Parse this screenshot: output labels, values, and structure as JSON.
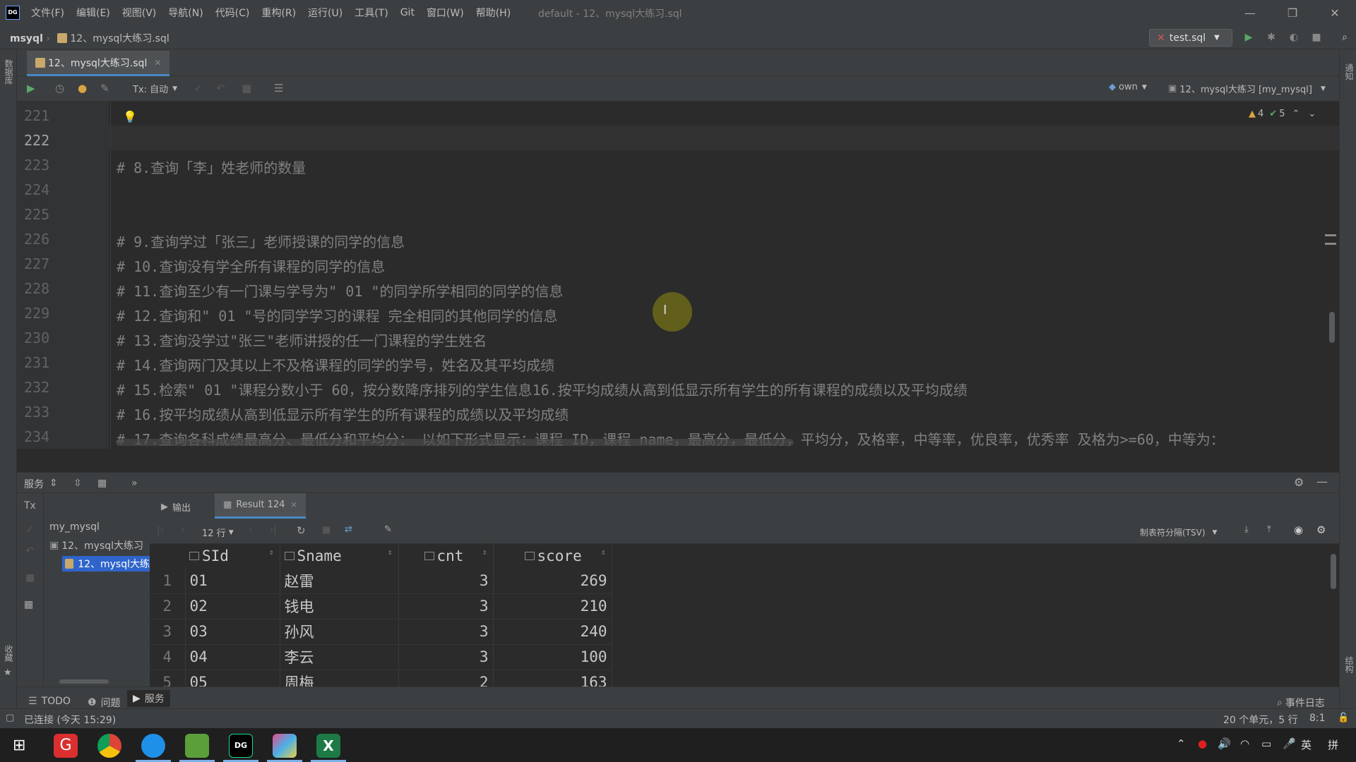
{
  "app": {
    "menu": [
      "文件(F)",
      "编辑(E)",
      "视图(V)",
      "导航(N)",
      "代码(C)",
      "重构(R)",
      "运行(U)",
      "工具(T)",
      "Git",
      "窗口(W)",
      "帮助(H)"
    ],
    "window_title": "default - 12、mysql大练习.sql"
  },
  "nav": {
    "project": "msyql",
    "file": "12、mysql大练习.sql",
    "run_config": "test.sql"
  },
  "editor": {
    "tab_label": "12、mysql大练习.sql",
    "tx_label": "Tx: 自动",
    "schema_label": "own",
    "datasource_label": "12、mysql大练习 [my_mysql]",
    "warnings": "4",
    "ok_count": "5",
    "lines": [
      {
        "n": "221",
        "text": ""
      },
      {
        "n": "222",
        "text": ""
      },
      {
        "n": "223",
        "text": "# 8.查询「李」姓老师的数量"
      },
      {
        "n": "224",
        "text": ""
      },
      {
        "n": "225",
        "text": ""
      },
      {
        "n": "226",
        "text": "# 9.查询学过「张三」老师授课的同学的信息"
      },
      {
        "n": "227",
        "text": "# 10.查询没有学全所有课程的同学的信息"
      },
      {
        "n": "228",
        "text": "# 11.查询至少有一门课与学号为\" 01 \"的同学所学相同的同学的信息"
      },
      {
        "n": "229",
        "text": "# 12.查询和\" 01 \"号的同学学习的课程 完全相同的其他同学的信息"
      },
      {
        "n": "230",
        "text": "# 13.查询没学过\"张三\"老师讲授的任一门课程的学生姓名"
      },
      {
        "n": "231",
        "text": "# 14.查询两门及其以上不及格课程的同学的学号，姓名及其平均成绩"
      },
      {
        "n": "232",
        "text": "# 15.检索\" 01 \"课程分数小于 60，按分数降序排列的学生信息16.按平均成绩从高到低显示所有学生的所有课程的成绩以及平均成绩"
      },
      {
        "n": "233",
        "text": "# 16.按平均成绩从高到低显示所有学生的所有课程的成绩以及平均成绩"
      },
      {
        "n": "234",
        "text": "# 17.查询各科成绩最高分、最低分和平均分： 以如下形式显示：课程 ID，课程 name，最高分，最低分，平均分，及格率，中等率，优良率，优秀率 及格为>=60，中等为："
      }
    ],
    "current_line": "222"
  },
  "services": {
    "title": "服务",
    "tree": {
      "root": "my_mysql",
      "child": "12、mysql大练习",
      "grandchild": "12、mysql大练"
    },
    "tabs": {
      "output": "输出",
      "result": "Result 124"
    },
    "rows_label": "12 行",
    "export_format": "制表符分隔(TSV)",
    "columns": [
      "SId",
      "Sname",
      "cnt",
      "score"
    ],
    "rows": [
      {
        "n": "1",
        "SId": "01",
        "Sname": "赵雷",
        "cnt": "3",
        "score": "269"
      },
      {
        "n": "2",
        "SId": "02",
        "Sname": "钱电",
        "cnt": "3",
        "score": "210"
      },
      {
        "n": "3",
        "SId": "03",
        "Sname": "孙风",
        "cnt": "3",
        "score": "240"
      },
      {
        "n": "4",
        "SId": "04",
        "Sname": "李云",
        "cnt": "3",
        "score": "100"
      },
      {
        "n": "5",
        "SId": "05",
        "Sname": "周梅",
        "cnt": "2",
        "score": "163"
      }
    ]
  },
  "tooltabs": {
    "todo": "TODO",
    "problems": "问题",
    "services": "服务",
    "event_log": "事件日志"
  },
  "status": {
    "connection": "已连接 (今天 15:29)",
    "selection": "20 个单元，5 行",
    "position": "8:1"
  },
  "strips": {
    "left_top": "数据库",
    "left_bottom": "收藏",
    "right_top": "通知",
    "right_bottom": "结构"
  },
  "taskbar": {
    "ime": "英",
    "ime2": "拼"
  },
  "colors": {
    "accent": "#4a88c7",
    "run_green": "#59a869",
    "selection_blue": "#2f65ca"
  }
}
